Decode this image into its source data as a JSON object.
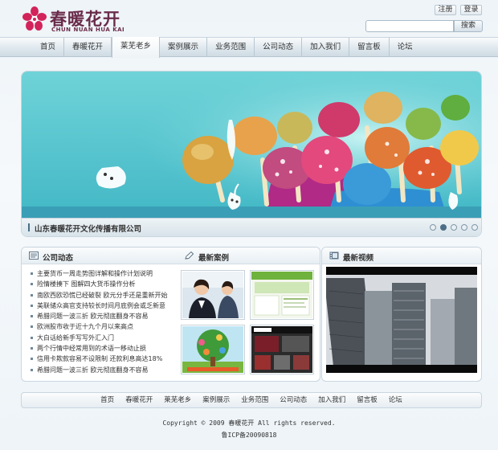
{
  "brand": {
    "name_cn": "春暖花开",
    "name_en": "CHUN NUAN HUA KAI",
    "color": "#6a2b4a",
    "logo_color": "#d2245a"
  },
  "top_links": {
    "register": "注册",
    "login": "登录"
  },
  "search": {
    "value": "",
    "placeholder": "",
    "button_label": "搜索"
  },
  "nav": {
    "items": [
      {
        "label": "首页",
        "active": false
      },
      {
        "label": "春暖花开",
        "active": false
      },
      {
        "label": "莱芜老乡",
        "active": true
      },
      {
        "label": "案例展示",
        "active": false
      },
      {
        "label": "业务范围",
        "active": false
      },
      {
        "label": "公司动态",
        "active": false
      },
      {
        "label": "加入我们",
        "active": false
      },
      {
        "label": "留言板",
        "active": false
      },
      {
        "label": "论坛",
        "active": false
      }
    ]
  },
  "banner": {
    "caption": "山东春暖花开文化传播有限公司",
    "slides": 5,
    "active_slide": 2,
    "image_icon": "colorful-mushroom-lollipops-illustration"
  },
  "news": {
    "title": "公司动态",
    "icon": "news-icon",
    "items": [
      "主要货币一周走势图详解和操作计划说明",
      "险情楼揍下 图解四大货币操作分析",
      "南欧西欧恐慌已经破裂 欧元分手还是重新开始",
      "美联储众高官支持较长时间月底例会或乏新意",
      "希腊问题一波三折 欧元彻底翻身不容易",
      "欧洲股市收于近十九个月以来高点",
      "大白话给新手写写外汇入门",
      "两个行情中经常用到的术语一移动止损",
      "信用卡欺款容易不设限制 还款利息高达18%",
      "希腊问题一波三折 欧元彻底翻身不容易"
    ]
  },
  "cases": {
    "title": "最新案例",
    "icon": "pencil-icon",
    "thumbs": [
      "business-people-photo",
      "green-website-screenshot",
      "cartoon-tree-poster",
      "dick-website-screenshot"
    ]
  },
  "video": {
    "title": "最新视频",
    "icon": "film-icon",
    "screen_icon": "city-skyscrapers-video"
  },
  "footer": {
    "links": [
      "首页",
      "春暖花开",
      "莱芜老乡",
      "案例展示",
      "业务范围",
      "公司动态",
      "加入我们",
      "留言板",
      "论坛"
    ],
    "copyright": "Copyright © 2009 春暖花开 All rights reserved.",
    "icp": "鲁ICP备20090818"
  }
}
